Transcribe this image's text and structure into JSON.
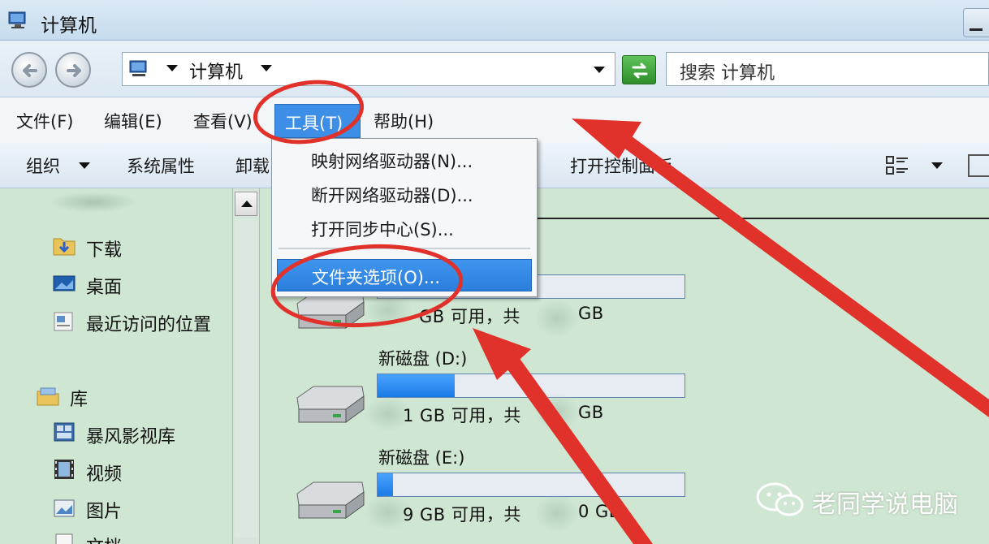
{
  "window": {
    "title": "计算机"
  },
  "address": {
    "path": "计算机",
    "search_placeholder": "搜索 计算机"
  },
  "menubar": {
    "file": "文件(F)",
    "edit": "编辑(E)",
    "view": "查看(V)",
    "tools": "工具(T)",
    "help": "帮助(H)"
  },
  "toolbar": {
    "organize": "组织",
    "system_properties": "系统属性",
    "uninstall": "卸载",
    "control_panel": "打开控制面板"
  },
  "tools_menu": {
    "items": [
      "映射网络驱动器(N)...",
      "断开网络驱动器(D)...",
      "打开同步中心(S)...",
      "文件夹选项(O)..."
    ],
    "highlighted_index": 3
  },
  "navpane": {
    "favorites": [
      "下载",
      "桌面",
      "最近访问的位置"
    ],
    "library_header": "库",
    "libraries": [
      "暴风影视库",
      "视频",
      "图片",
      "文档"
    ]
  },
  "drives": [
    {
      "name": "",
      "free_text": "GB 可用，共",
      "total_text": "GB",
      "used_fraction": 0.0
    },
    {
      "name": "新磁盘 (D:)",
      "free_text": "1 GB 可用，共",
      "total_text": "GB",
      "used_fraction": 0.25
    },
    {
      "name": "新磁盘 (E:)",
      "free_text": "9 GB 可用，共",
      "total_text": "0 GB",
      "used_fraction": 0.05
    }
  ],
  "watermark": {
    "text": "老同学说电脑"
  },
  "colors": {
    "accent_highlight": "#3d8ee6",
    "annotation_red": "#e0322a",
    "content_bg": "#cfe7d2",
    "drive_fill": "#1a7ae6"
  }
}
